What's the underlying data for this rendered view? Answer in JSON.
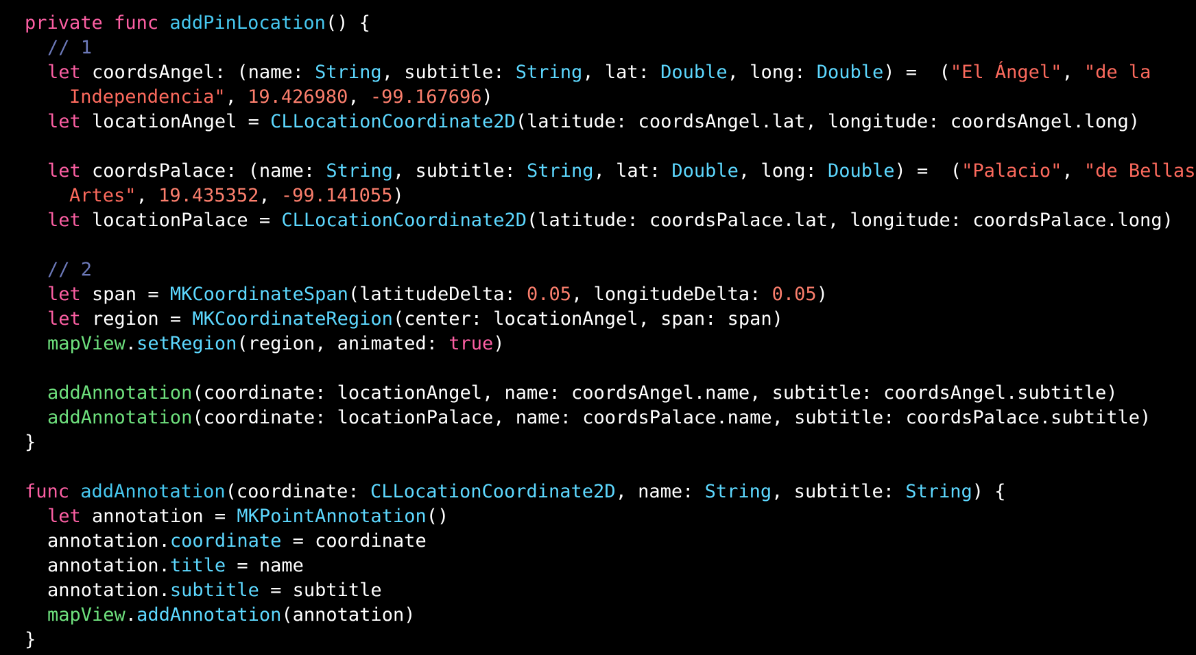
{
  "code": {
    "lines": [
      {
        "indent": 0,
        "tokens": [
          {
            "t": "private",
            "k": "keyword"
          },
          {
            "t": " ",
            "k": "plain"
          },
          {
            "t": "func",
            "k": "keyword"
          },
          {
            "t": " ",
            "k": "plain"
          },
          {
            "t": "addPinLocation",
            "k": "func-name"
          },
          {
            "t": "() {",
            "k": "plain"
          }
        ]
      },
      {
        "indent": 1,
        "tokens": [
          {
            "t": "// 1",
            "k": "comment"
          }
        ]
      },
      {
        "indent": 1,
        "tokens": [
          {
            "t": "let",
            "k": "keyword"
          },
          {
            "t": " coordsAngel: (name: ",
            "k": "plain"
          },
          {
            "t": "String",
            "k": "type"
          },
          {
            "t": ", subtitle: ",
            "k": "plain"
          },
          {
            "t": "String",
            "k": "type"
          },
          {
            "t": ", lat: ",
            "k": "plain"
          },
          {
            "t": "Double",
            "k": "type"
          },
          {
            "t": ", long: ",
            "k": "plain"
          },
          {
            "t": "Double",
            "k": "type"
          },
          {
            "t": ") =  (",
            "k": "plain"
          },
          {
            "t": "\"El Ángel\"",
            "k": "string"
          },
          {
            "t": ", ",
            "k": "plain"
          },
          {
            "t": "\"de la",
            "k": "string"
          }
        ]
      },
      {
        "indent": 2,
        "tokens": [
          {
            "t": "Independencia\"",
            "k": "string"
          },
          {
            "t": ", ",
            "k": "plain"
          },
          {
            "t": "19.426980",
            "k": "number"
          },
          {
            "t": ", ",
            "k": "plain"
          },
          {
            "t": "-99.167696",
            "k": "number"
          },
          {
            "t": ")",
            "k": "plain"
          }
        ]
      },
      {
        "indent": 1,
        "tokens": [
          {
            "t": "let",
            "k": "keyword"
          },
          {
            "t": " locationAngel = ",
            "k": "plain"
          },
          {
            "t": "CLLocationCoordinate2D",
            "k": "type"
          },
          {
            "t": "(latitude: coordsAngel.lat, longitude: coordsAngel.long)",
            "k": "plain"
          }
        ]
      },
      {
        "indent": 0,
        "tokens": []
      },
      {
        "indent": 1,
        "tokens": [
          {
            "t": "let",
            "k": "keyword"
          },
          {
            "t": " coordsPalace: (name: ",
            "k": "plain"
          },
          {
            "t": "String",
            "k": "type"
          },
          {
            "t": ", subtitle: ",
            "k": "plain"
          },
          {
            "t": "String",
            "k": "type"
          },
          {
            "t": ", lat: ",
            "k": "plain"
          },
          {
            "t": "Double",
            "k": "type"
          },
          {
            "t": ", long: ",
            "k": "plain"
          },
          {
            "t": "Double",
            "k": "type"
          },
          {
            "t": ") =  (",
            "k": "plain"
          },
          {
            "t": "\"Palacio\"",
            "k": "string"
          },
          {
            "t": ", ",
            "k": "plain"
          },
          {
            "t": "\"de Bellas",
            "k": "string"
          }
        ]
      },
      {
        "indent": 2,
        "tokens": [
          {
            "t": "Artes\"",
            "k": "string"
          },
          {
            "t": ", ",
            "k": "plain"
          },
          {
            "t": "19.435352",
            "k": "number"
          },
          {
            "t": ", ",
            "k": "plain"
          },
          {
            "t": "-99.141055",
            "k": "number"
          },
          {
            "t": ")",
            "k": "plain"
          }
        ]
      },
      {
        "indent": 1,
        "tokens": [
          {
            "t": "let",
            "k": "keyword"
          },
          {
            "t": " locationPalace = ",
            "k": "plain"
          },
          {
            "t": "CLLocationCoordinate2D",
            "k": "type"
          },
          {
            "t": "(latitude: coordsPalace.lat, longitude: coordsPalace.long)",
            "k": "plain"
          }
        ]
      },
      {
        "indent": 0,
        "tokens": []
      },
      {
        "indent": 1,
        "tokens": [
          {
            "t": "// 2",
            "k": "comment"
          }
        ]
      },
      {
        "indent": 1,
        "tokens": [
          {
            "t": "let",
            "k": "keyword"
          },
          {
            "t": " span = ",
            "k": "plain"
          },
          {
            "t": "MKCoordinateSpan",
            "k": "type"
          },
          {
            "t": "(latitudeDelta: ",
            "k": "plain"
          },
          {
            "t": "0.05",
            "k": "number"
          },
          {
            "t": ", longitudeDelta: ",
            "k": "plain"
          },
          {
            "t": "0.05",
            "k": "number"
          },
          {
            "t": ")",
            "k": "plain"
          }
        ]
      },
      {
        "indent": 1,
        "tokens": [
          {
            "t": "let",
            "k": "keyword"
          },
          {
            "t": " region = ",
            "k": "plain"
          },
          {
            "t": "MKCoordinateRegion",
            "k": "type"
          },
          {
            "t": "(center: locationAngel, span: span)",
            "k": "plain"
          }
        ]
      },
      {
        "indent": 1,
        "tokens": [
          {
            "t": "mapView",
            "k": "project"
          },
          {
            "t": ".",
            "k": "plain"
          },
          {
            "t": "setRegion",
            "k": "member"
          },
          {
            "t": "(region, animated: ",
            "k": "plain"
          },
          {
            "t": "true",
            "k": "keyword"
          },
          {
            "t": ")",
            "k": "plain"
          }
        ]
      },
      {
        "indent": 0,
        "tokens": []
      },
      {
        "indent": 1,
        "tokens": [
          {
            "t": "addAnnotation",
            "k": "project"
          },
          {
            "t": "(coordinate: locationAngel, name: coordsAngel.name, subtitle: coordsAngel.subtitle)",
            "k": "plain"
          }
        ]
      },
      {
        "indent": 1,
        "tokens": [
          {
            "t": "addAnnotation",
            "k": "project"
          },
          {
            "t": "(coordinate: locationPalace, name: coordsPalace.name, subtitle: coordsPalace.subtitle)",
            "k": "plain"
          }
        ]
      },
      {
        "indent": 0,
        "tokens": [
          {
            "t": "}",
            "k": "plain"
          }
        ]
      },
      {
        "indent": 0,
        "tokens": []
      },
      {
        "indent": 0,
        "tokens": [
          {
            "t": "func",
            "k": "keyword"
          },
          {
            "t": " ",
            "k": "plain"
          },
          {
            "t": "addAnnotation",
            "k": "func-name"
          },
          {
            "t": "(coordinate: ",
            "k": "plain"
          },
          {
            "t": "CLLocationCoordinate2D",
            "k": "type"
          },
          {
            "t": ", name: ",
            "k": "plain"
          },
          {
            "t": "String",
            "k": "type"
          },
          {
            "t": ", subtitle: ",
            "k": "plain"
          },
          {
            "t": "String",
            "k": "type"
          },
          {
            "t": ") {",
            "k": "plain"
          }
        ]
      },
      {
        "indent": 1,
        "tokens": [
          {
            "t": "let",
            "k": "keyword"
          },
          {
            "t": " annotation = ",
            "k": "plain"
          },
          {
            "t": "MKPointAnnotation",
            "k": "type"
          },
          {
            "t": "()",
            "k": "plain"
          }
        ]
      },
      {
        "indent": 1,
        "tokens": [
          {
            "t": "annotation.",
            "k": "plain"
          },
          {
            "t": "coordinate",
            "k": "member"
          },
          {
            "t": " = coordinate",
            "k": "plain"
          }
        ]
      },
      {
        "indent": 1,
        "tokens": [
          {
            "t": "annotation.",
            "k": "plain"
          },
          {
            "t": "title",
            "k": "member"
          },
          {
            "t": " = name",
            "k": "plain"
          }
        ]
      },
      {
        "indent": 1,
        "tokens": [
          {
            "t": "annotation.",
            "k": "plain"
          },
          {
            "t": "subtitle",
            "k": "member"
          },
          {
            "t": " = subtitle",
            "k": "plain"
          }
        ]
      },
      {
        "indent": 1,
        "tokens": [
          {
            "t": "mapView",
            "k": "project"
          },
          {
            "t": ".",
            "k": "plain"
          },
          {
            "t": "addAnnotation",
            "k": "member"
          },
          {
            "t": "(annotation)",
            "k": "plain"
          }
        ]
      },
      {
        "indent": 0,
        "tokens": [
          {
            "t": "}",
            "k": "plain"
          }
        ]
      }
    ]
  },
  "colors": {
    "background": "#000000",
    "keyword": "#fc5fa3",
    "type": "#5dd8ff",
    "string": "#fc6a5d",
    "number": "#fc7f6d",
    "comment": "#6c79b9",
    "project": "#6ee07d",
    "plain": "#ffffff"
  }
}
